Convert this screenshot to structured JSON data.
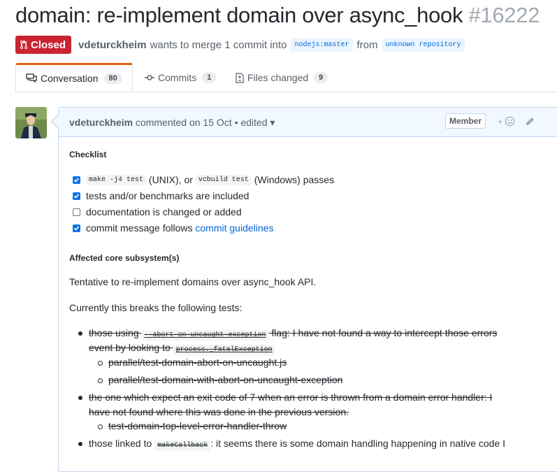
{
  "pr": {
    "title": "domain: re-implement domain over async_hook",
    "number": "#16222",
    "state": "Closed",
    "author": "vdeturckheim",
    "action": "wants to merge 1 commit into",
    "base_branch": "nodejs:master",
    "from_word": "from",
    "head_branch": "unknown repository"
  },
  "tabs": [
    {
      "label": "Conversation",
      "count": "80",
      "icon": "comment-discussion-icon"
    },
    {
      "label": "Commits",
      "count": "1",
      "icon": "git-commit-icon"
    },
    {
      "label": "Files changed",
      "count": "9",
      "icon": "file-diff-icon"
    }
  ],
  "comment": {
    "author": "vdeturckheim",
    "meta": "commented on 15 Oct • edited ▾",
    "role_badge": "Member",
    "checklist_heading": "Checklist",
    "tasks": [
      {
        "checked": true,
        "code1": "make -j4 test",
        "text1": "(UNIX), or",
        "code2": "vcbuild test",
        "text2": "(Windows) passes"
      },
      {
        "checked": true,
        "text": "tests and/or benchmarks are included"
      },
      {
        "checked": false,
        "text": "documentation is changed or added"
      },
      {
        "checked": true,
        "text": "commit message follows",
        "link": "commit guidelines"
      }
    ],
    "subsystem_heading": "Affected core subsystem(s)",
    "para1": "Tentative to re-implement domains over async_hook API.",
    "para2": "Currently this breaks the following tests:",
    "items": {
      "i1_a": "those using",
      "i1_code": "--abort-on-uncaught-exception",
      "i1_b": "flag: I have not found a way to intercept those errors",
      "i1_c": "event by looking to",
      "i1_code2": "process._fatalException",
      "i1_sub1": "parallel/test-domain-abort-on-uncaught.js",
      "i1_sub2": "parallel/test-domain-with-abort-on-uncaught-exception",
      "i2_a": "the one which expect an exit code of 7 when an error is thrown from a domain error handler: I",
      "i2_b": "have not found where this was done in the previous version.",
      "i2_sub1": "test-domain-top-level-error-handler-throw",
      "i3_a": "those linked to",
      "i3_code": "makeCallback",
      "i3_b": ": it seems there is some domain handling happening in native code I"
    }
  },
  "colors": {
    "closed": "#cb2431",
    "link": "#0366d6",
    "tab_accent": "#e36209"
  }
}
